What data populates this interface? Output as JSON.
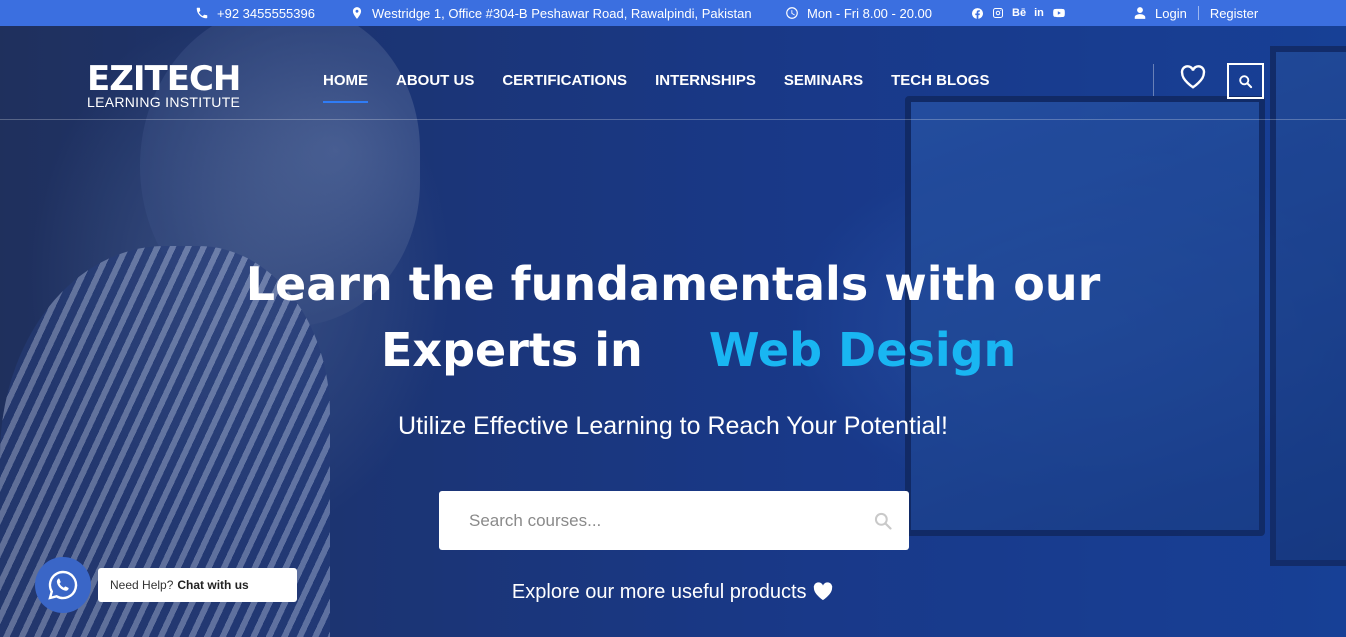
{
  "topbar": {
    "phone": "+92 3455555396",
    "address": "Westridge 1, Office #304-B Peshawar Road, Rawalpindi, Pakistan",
    "hours": "Mon - Fri 8.00 - 20.00",
    "social": [
      "facebook-icon",
      "instagram-icon",
      "behance-icon",
      "linkedin-icon",
      "youtube-icon"
    ],
    "behance_label": "Bē",
    "linkedin_label": "in",
    "login": "Login",
    "register": "Register"
  },
  "logo": {
    "title": "EZITECH",
    "subtitle": "LEARNING INSTITUTE"
  },
  "nav": {
    "items": [
      "HOME",
      "ABOUT US",
      "CERTIFICATIONS",
      "INTERNSHIPS",
      "SEMINARS",
      "TECH BLOGS"
    ],
    "active": "HOME"
  },
  "hero": {
    "line1": "Learn the fundamentals with our",
    "line2_prefix": "Experts in",
    "line2_accent": "Web Design",
    "subtitle": "Utilize Effective Learning to Reach Your Potential!",
    "search_placeholder": "Search courses...",
    "explore": "Explore our more useful products"
  },
  "whatsapp": {
    "prefix": "Need Help?",
    "cta": "Chat with us"
  },
  "colors": {
    "topbar": "#3b6fe0",
    "accent": "#19b6f2",
    "active_underline": "#2f7cf6",
    "whatsapp": "#3a66c7"
  }
}
